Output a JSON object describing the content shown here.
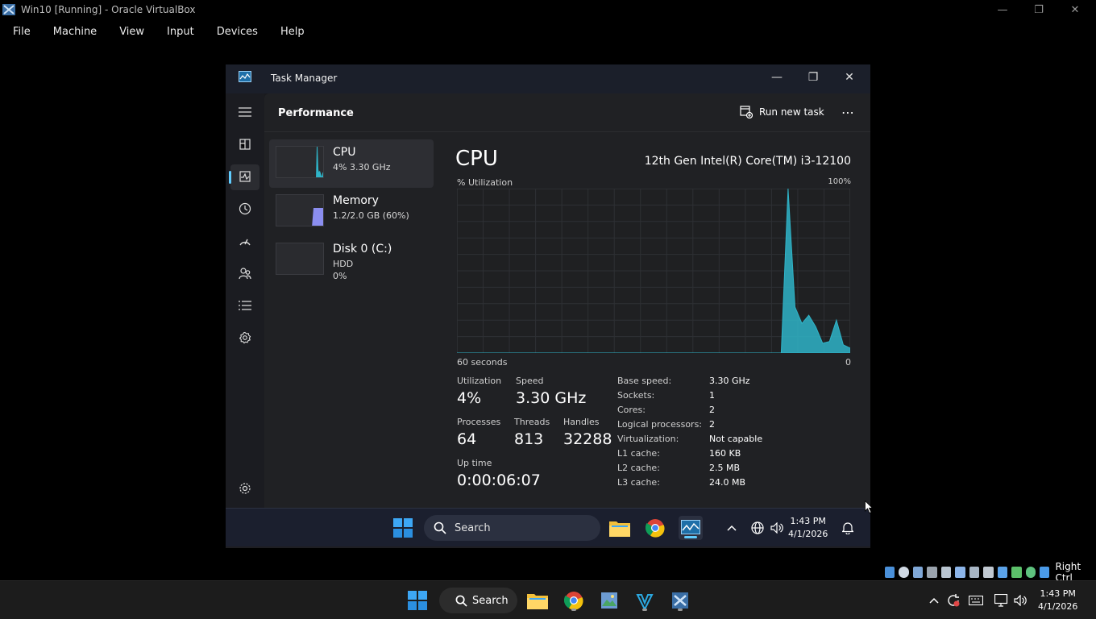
{
  "host": {
    "window_title": "Win10 [Running] - Oracle VirtualBox",
    "menu": [
      "File",
      "Machine",
      "View",
      "Input",
      "Devices",
      "Help"
    ],
    "status_right": "Right Ctrl",
    "clock_time": "1:43 PM",
    "clock_date": "4/1/2026",
    "search_label": "Search"
  },
  "task_manager": {
    "title": "Task Manager",
    "page_title": "Performance",
    "run_new_task": "Run new task",
    "more": "⋯",
    "devices": [
      {
        "name": "CPU",
        "sub1": "4%  3.30 GHz",
        "sub2": ""
      },
      {
        "name": "Memory",
        "sub1": "1.2/2.0 GB (60%)",
        "sub2": ""
      },
      {
        "name": "Disk 0 (C:)",
        "sub1": "HDD",
        "sub2": "0%"
      }
    ],
    "detail": {
      "title": "CPU",
      "model": "12th Gen Intel(R) Core(TM) i3-12100",
      "util_label": "% Utilization",
      "max_label": "100%",
      "time_label": "60 seconds",
      "min_label": "0",
      "stats": {
        "utilization_label": "Utilization",
        "utilization": "4%",
        "speed_label": "Speed",
        "speed": "3.30 GHz",
        "processes_label": "Processes",
        "processes": "64",
        "threads_label": "Threads",
        "threads": "813",
        "handles_label": "Handles",
        "handles": "32288",
        "uptime_label": "Up time",
        "uptime": "0:00:06:07"
      },
      "specs": [
        {
          "k": "Base speed:",
          "v": "3.30 GHz"
        },
        {
          "k": "Sockets:",
          "v": "1"
        },
        {
          "k": "Cores:",
          "v": "2"
        },
        {
          "k": "Logical processors:",
          "v": "2"
        },
        {
          "k": "Virtualization:",
          "v": "Not capable"
        },
        {
          "k": "L1 cache:",
          "v": "160 KB"
        },
        {
          "k": "L2 cache:",
          "v": "2.5 MB"
        },
        {
          "k": "L3 cache:",
          "v": "24.0 MB"
        }
      ]
    },
    "cpu_graph": {
      "values": [
        0,
        0,
        0,
        0,
        0,
        0,
        0,
        0,
        0,
        0,
        0,
        0,
        0,
        0,
        0,
        0,
        0,
        0,
        0,
        0,
        0,
        0,
        0,
        0,
        0,
        0,
        0,
        0,
        0,
        0,
        0,
        0,
        0,
        0,
        0,
        0,
        0,
        0,
        0,
        0,
        0,
        0,
        0,
        0,
        0,
        0,
        0,
        0,
        100,
        28,
        18,
        23,
        16,
        6,
        7,
        20,
        5,
        3
      ],
      "color": "#2fb4c8",
      "memory_fill": 60
    }
  },
  "guest_taskbar": {
    "search_label": "Search",
    "clock_time": "1:43 PM",
    "clock_date": "4/1/2026"
  },
  "colors": {
    "accent": "#60cdff",
    "cpu_line": "#2fb4c8",
    "memory": "#8b8ef0"
  }
}
